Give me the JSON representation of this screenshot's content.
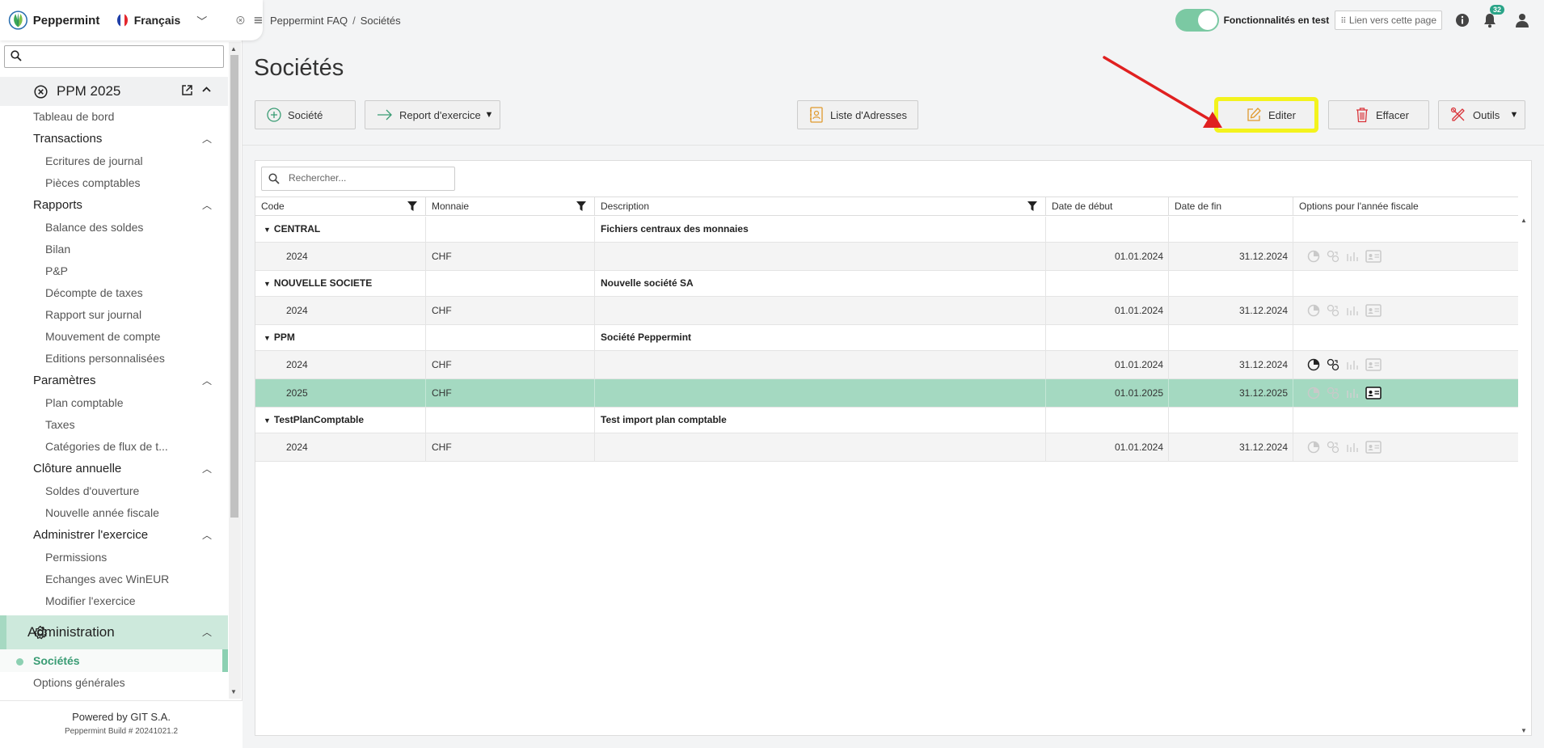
{
  "app": {
    "name": "Peppermint",
    "language": "Français"
  },
  "sidebar": {
    "search_placeholder": "",
    "section_title": "PPM 2025",
    "dashboard": "Tableau de bord",
    "groups": [
      {
        "label": "Transactions",
        "items": [
          "Ecritures de journal",
          "Pièces comptables"
        ]
      },
      {
        "label": "Rapports",
        "items": [
          "Balance des soldes",
          "Bilan",
          "P&P",
          "Décompte de taxes",
          "Rapport sur journal",
          "Mouvement de compte",
          "Editions personnalisées"
        ]
      },
      {
        "label": "Paramètres",
        "items": [
          "Plan comptable",
          "Taxes",
          "Catégories de flux de t..."
        ]
      },
      {
        "label": "Clôture annuelle",
        "items": [
          "Soldes d'ouverture",
          "Nouvelle année fiscale"
        ]
      },
      {
        "label": "Administrer l'exercice",
        "items": [
          "Permissions",
          "Echanges avec WinEUR",
          "Modifier l'exercice"
        ]
      }
    ],
    "admin_title": "Administration",
    "admin_items": [
      "Sociétés",
      "Options générales"
    ],
    "footer_powered": "Powered by GIT S.A.",
    "footer_build": "Peppermint Build # 20241021.2"
  },
  "topbar": {
    "breadcrumb": [
      "Peppermint FAQ",
      "Sociétés"
    ],
    "breadcrumb_sep": "/",
    "test_features_label": "Fonctionnalités en test",
    "test_features_on": true,
    "permalink_label": "Lien vers cette page",
    "notifications_count": "32"
  },
  "page": {
    "title": "Sociétés",
    "toolbar": {
      "new_company": "Société",
      "fiscal_report": "Report d'exercice",
      "address_list": "Liste d'Adresses",
      "edit": "Editer",
      "delete": "Effacer",
      "tools": "Outils"
    }
  },
  "grid": {
    "search_placeholder": "Rechercher...",
    "columns": [
      "Code",
      "Monnaie",
      "Description",
      "Date de début",
      "Date de fin",
      "Options pour l'année fiscale"
    ],
    "groups": [
      {
        "code": "CENTRAL",
        "description": "Fichiers centraux des monnaies",
        "rows": [
          {
            "year": "2024",
            "currency": "CHF",
            "description": "",
            "start": "01.01.2024",
            "end": "31.12.2024",
            "selected": false
          }
        ]
      },
      {
        "code": "NOUVELLE SOCIETE",
        "description": "Nouvelle société SA",
        "rows": [
          {
            "year": "2024",
            "currency": "CHF",
            "description": "",
            "start": "01.01.2024",
            "end": "31.12.2024",
            "selected": false
          }
        ]
      },
      {
        "code": "PPM",
        "description": "Société Peppermint",
        "rows": [
          {
            "year": "2024",
            "currency": "CHF",
            "description": "",
            "start": "01.01.2024",
            "end": "31.12.2024",
            "selected": false
          },
          {
            "year": "2025",
            "currency": "CHF",
            "description": "",
            "start": "01.01.2025",
            "end": "31.12.2025",
            "selected": true
          }
        ]
      },
      {
        "code": "TestPlanComptable",
        "description": "Test import plan comptable",
        "rows": [
          {
            "year": "2024",
            "currency": "CHF",
            "description": "",
            "start": "01.01.2024",
            "end": "31.12.2024",
            "selected": false
          }
        ]
      }
    ]
  },
  "colors": {
    "accent": "#3a9c74",
    "selected_row": "#a4d9c1",
    "highlight": "#f3f31d",
    "arrow": "#e02020"
  }
}
